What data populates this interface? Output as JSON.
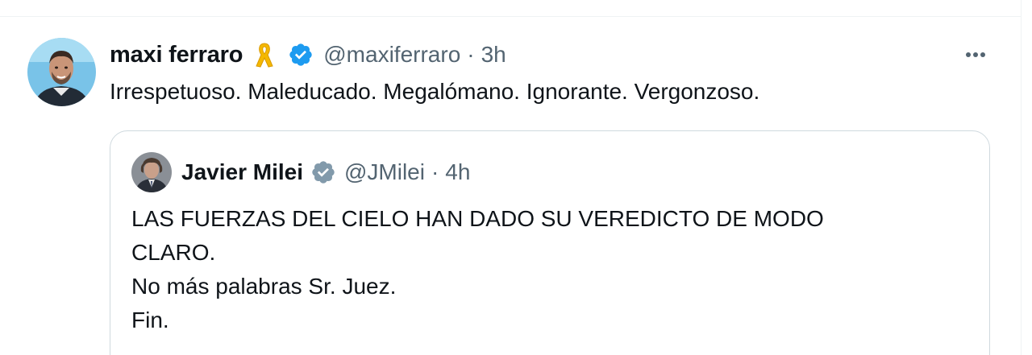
{
  "colors": {
    "text_primary": "#0f1419",
    "text_secondary": "#536471",
    "verified_blue": "#1d9bf0",
    "verified_gray": "#829aab",
    "ribbon_yellow": "#f5b800",
    "border": "#cfd9de"
  },
  "tweet": {
    "author": {
      "name": "maxi ferraro",
      "badge_icon": "yellow-ribbon-icon",
      "verified_icon": "blue-verified-badge-icon",
      "handle": "@maxiferraro",
      "separator": "·",
      "time": "3h"
    },
    "more_icon": "more-horizontal-icon",
    "text": "Irrespetuoso. Maleducado. Megalómano. Ignorante. Vergonzoso.",
    "quoted": {
      "author": {
        "name": "Javier Milei",
        "verified_icon": "gray-verified-badge-icon",
        "handle": "@JMilei",
        "separator": "·",
        "time": "4h"
      },
      "lines": [
        "LAS FUERZAS DEL CIELO HAN DADO SU VEREDICTO DE MODO",
        "CLARO.",
        "No más palabras Sr. Juez.",
        "Fin."
      ]
    }
  }
}
